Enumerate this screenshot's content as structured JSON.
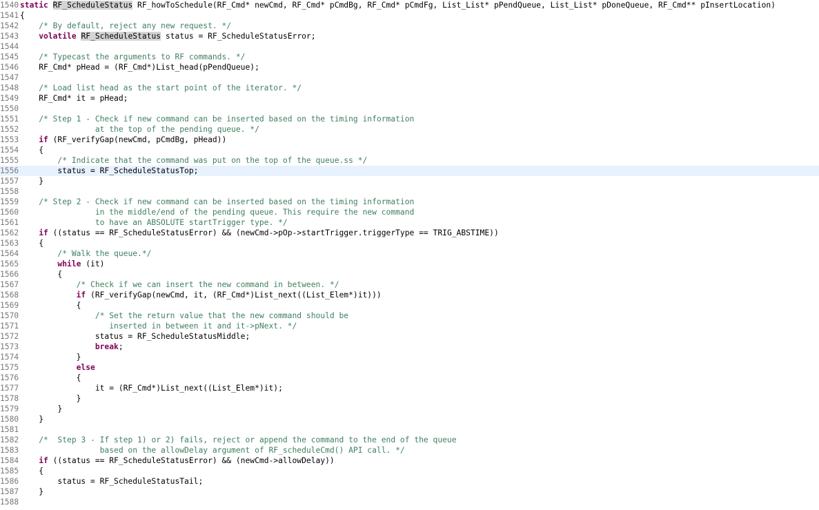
{
  "editor": {
    "current_line": 1556,
    "highlight_word": "RF_ScheduleStatus",
    "colors": {
      "keyword": "#7f0055",
      "comment": "#3f7f5f",
      "line_number": "#787878",
      "current_line_bg": "#e8f2fe",
      "occurrence_bg": "#d4d4d4"
    },
    "lines": [
      {
        "n": "1540",
        "tokens": [
          {
            "t": "kw",
            "v": "static"
          },
          {
            "t": "pl",
            "v": " "
          },
          {
            "t": "hl",
            "v": "RF_ScheduleStatus"
          },
          {
            "t": "pl",
            "v": " RF_howToSchedule(RF_Cmd* newCmd, RF_Cmd* pCmdBg, RF_Cmd* pCmdFg, List_List* pPendQueue, List_List* pDoneQueue, RF_Cmd** pInsertLocation)"
          }
        ]
      },
      {
        "n": "1541",
        "tokens": [
          {
            "t": "pl",
            "v": "{"
          }
        ]
      },
      {
        "n": "1542",
        "tokens": [
          {
            "t": "pl",
            "v": "    "
          },
          {
            "t": "cm",
            "v": "/* By default, reject any new request. */"
          }
        ]
      },
      {
        "n": "1543",
        "tokens": [
          {
            "t": "pl",
            "v": "    "
          },
          {
            "t": "kw",
            "v": "volatile"
          },
          {
            "t": "pl",
            "v": " "
          },
          {
            "t": "hl",
            "v": "RF_ScheduleStatus"
          },
          {
            "t": "pl",
            "v": " status = RF_ScheduleStatusError;"
          }
        ]
      },
      {
        "n": "1544",
        "tokens": []
      },
      {
        "n": "1545",
        "tokens": [
          {
            "t": "pl",
            "v": "    "
          },
          {
            "t": "cm",
            "v": "/* Typecast the arguments to RF commands. */"
          }
        ]
      },
      {
        "n": "1546",
        "tokens": [
          {
            "t": "pl",
            "v": "    RF_Cmd* pHead = (RF_Cmd*)List_head(pPendQueue);"
          }
        ]
      },
      {
        "n": "1547",
        "tokens": []
      },
      {
        "n": "1548",
        "tokens": [
          {
            "t": "pl",
            "v": "    "
          },
          {
            "t": "cm",
            "v": "/* Load list head as the start point of the iterator. */"
          }
        ]
      },
      {
        "n": "1549",
        "tokens": [
          {
            "t": "pl",
            "v": "    RF_Cmd* it = pHead;"
          }
        ]
      },
      {
        "n": "1550",
        "tokens": []
      },
      {
        "n": "1551",
        "tokens": [
          {
            "t": "pl",
            "v": "    "
          },
          {
            "t": "cm",
            "v": "/* Step 1 - Check if new command can be inserted based on the timing information"
          }
        ]
      },
      {
        "n": "1552",
        "tokens": [
          {
            "t": "cm",
            "v": "                at the top of the pending queue. */"
          }
        ]
      },
      {
        "n": "1553",
        "tokens": [
          {
            "t": "pl",
            "v": "    "
          },
          {
            "t": "kw",
            "v": "if"
          },
          {
            "t": "pl",
            "v": " (RF_verifyGap(newCmd, pCmdBg, pHead))"
          }
        ]
      },
      {
        "n": "1554",
        "tokens": [
          {
            "t": "pl",
            "v": "    {"
          }
        ]
      },
      {
        "n": "1555",
        "tokens": [
          {
            "t": "pl",
            "v": "        "
          },
          {
            "t": "cm",
            "v": "/* Indicate that the command was put on the top of the queue.ss */"
          }
        ]
      },
      {
        "n": "1556",
        "tokens": [
          {
            "t": "pl",
            "v": "        status = RF_ScheduleStatusTop;"
          }
        ]
      },
      {
        "n": "1557",
        "tokens": [
          {
            "t": "pl",
            "v": "    }"
          }
        ]
      },
      {
        "n": "1558",
        "tokens": []
      },
      {
        "n": "1559",
        "tokens": [
          {
            "t": "pl",
            "v": "    "
          },
          {
            "t": "cm",
            "v": "/* Step 2 - Check if new command can be inserted based on the timing information"
          }
        ]
      },
      {
        "n": "1560",
        "tokens": [
          {
            "t": "cm",
            "v": "                in the middle/end of the pending queue. This require the new command"
          }
        ]
      },
      {
        "n": "1561",
        "tokens": [
          {
            "t": "cm",
            "v": "                to have an ABSOLUTE startTrigger type. */"
          }
        ]
      },
      {
        "n": "1562",
        "tokens": [
          {
            "t": "pl",
            "v": "    "
          },
          {
            "t": "kw",
            "v": "if"
          },
          {
            "t": "pl",
            "v": " ((status == RF_ScheduleStatusError) && (newCmd->pOp->startTrigger.triggerType == TRIG_ABSTIME))"
          }
        ]
      },
      {
        "n": "1563",
        "tokens": [
          {
            "t": "pl",
            "v": "    {"
          }
        ]
      },
      {
        "n": "1564",
        "tokens": [
          {
            "t": "pl",
            "v": "        "
          },
          {
            "t": "cm",
            "v": "/* Walk the queue.*/"
          }
        ]
      },
      {
        "n": "1565",
        "tokens": [
          {
            "t": "pl",
            "v": "        "
          },
          {
            "t": "kw",
            "v": "while"
          },
          {
            "t": "pl",
            "v": " (it)"
          }
        ]
      },
      {
        "n": "1566",
        "tokens": [
          {
            "t": "pl",
            "v": "        {"
          }
        ]
      },
      {
        "n": "1567",
        "tokens": [
          {
            "t": "pl",
            "v": "            "
          },
          {
            "t": "cm",
            "v": "/* Check if we can insert the new command in between. */"
          }
        ]
      },
      {
        "n": "1568",
        "tokens": [
          {
            "t": "pl",
            "v": "            "
          },
          {
            "t": "kw",
            "v": "if"
          },
          {
            "t": "pl",
            "v": " (RF_verifyGap(newCmd, it, (RF_Cmd*)List_next((List_Elem*)it)))"
          }
        ]
      },
      {
        "n": "1569",
        "tokens": [
          {
            "t": "pl",
            "v": "            {"
          }
        ]
      },
      {
        "n": "1570",
        "tokens": [
          {
            "t": "pl",
            "v": "                "
          },
          {
            "t": "cm",
            "v": "/* Set the return value that the new command should be"
          }
        ]
      },
      {
        "n": "1571",
        "tokens": [
          {
            "t": "cm",
            "v": "                   inserted in between it and it->pNext. */"
          }
        ]
      },
      {
        "n": "1572",
        "tokens": [
          {
            "t": "pl",
            "v": "                status = RF_ScheduleStatusMiddle;"
          }
        ]
      },
      {
        "n": "1573",
        "tokens": [
          {
            "t": "pl",
            "v": "                "
          },
          {
            "t": "kw",
            "v": "break"
          },
          {
            "t": "pl",
            "v": ";"
          }
        ]
      },
      {
        "n": "1574",
        "tokens": [
          {
            "t": "pl",
            "v": "            }"
          }
        ]
      },
      {
        "n": "1575",
        "tokens": [
          {
            "t": "pl",
            "v": "            "
          },
          {
            "t": "kw",
            "v": "else"
          }
        ]
      },
      {
        "n": "1576",
        "tokens": [
          {
            "t": "pl",
            "v": "            {"
          }
        ]
      },
      {
        "n": "1577",
        "tokens": [
          {
            "t": "pl",
            "v": "                it = (RF_Cmd*)List_next((List_Elem*)it);"
          }
        ]
      },
      {
        "n": "1578",
        "tokens": [
          {
            "t": "pl",
            "v": "            }"
          }
        ]
      },
      {
        "n": "1579",
        "tokens": [
          {
            "t": "pl",
            "v": "        }"
          }
        ]
      },
      {
        "n": "1580",
        "tokens": [
          {
            "t": "pl",
            "v": "    }"
          }
        ]
      },
      {
        "n": "1581",
        "tokens": []
      },
      {
        "n": "1582",
        "tokens": [
          {
            "t": "pl",
            "v": "    "
          },
          {
            "t": "cm",
            "v": "/*  Step 3 - If step 1) or 2) fails, reject or append the command to the end of the queue"
          }
        ]
      },
      {
        "n": "1583",
        "tokens": [
          {
            "t": "cm",
            "v": "                 based on the allowDelay argument of RF_scheduleCmd() API call. */"
          }
        ]
      },
      {
        "n": "1584",
        "tokens": [
          {
            "t": "pl",
            "v": "    "
          },
          {
            "t": "kw",
            "v": "if"
          },
          {
            "t": "pl",
            "v": " ((status == RF_ScheduleStatusError) && (newCmd->allowDelay))"
          }
        ]
      },
      {
        "n": "1585",
        "tokens": [
          {
            "t": "pl",
            "v": "    {"
          }
        ]
      },
      {
        "n": "1586",
        "tokens": [
          {
            "t": "pl",
            "v": "        status = RF_ScheduleStatusTail;"
          }
        ]
      },
      {
        "n": "1587",
        "tokens": [
          {
            "t": "pl",
            "v": "    }"
          }
        ]
      },
      {
        "n": "1588",
        "tokens": []
      }
    ]
  }
}
